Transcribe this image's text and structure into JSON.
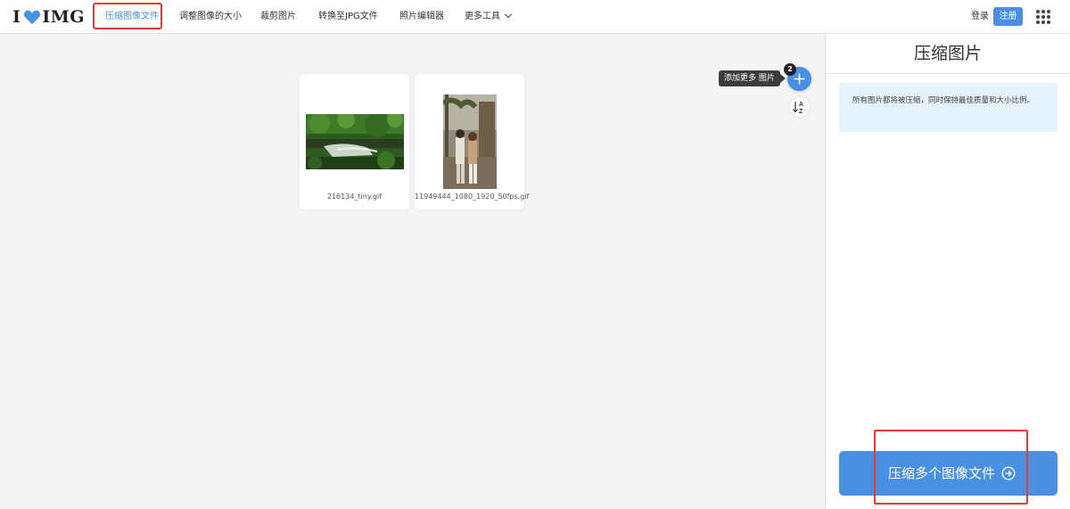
{
  "header": {
    "logo_left": "I",
    "logo_right": "IMG",
    "nav": [
      {
        "label": "压缩图像文件",
        "active": true
      },
      {
        "label": "调整图像的大小"
      },
      {
        "label": "裁剪图片"
      },
      {
        "label": "转换至JPG文件"
      },
      {
        "label": "照片编辑器"
      },
      {
        "label": "更多工具"
      }
    ],
    "login_label": "登录",
    "signup_label": "注册"
  },
  "files": [
    {
      "name": "216134_tiny.gif"
    },
    {
      "name": "11949444_1080_1920_50fps.gif"
    }
  ],
  "actions": {
    "add_tooltip": "添加更多 图片",
    "file_count": "2",
    "add_icon": "plus-icon",
    "sort_icon": "sort-az-icon"
  },
  "panel": {
    "title": "压缩图片",
    "info": "所有图片都将被压缩，同时保持最佳质量和大小比例。",
    "compress_label": "压缩多个图像文件"
  },
  "colors": {
    "accent": "#4a90e2",
    "highlight": "#e53935",
    "info_bg": "#e3f2fd"
  }
}
